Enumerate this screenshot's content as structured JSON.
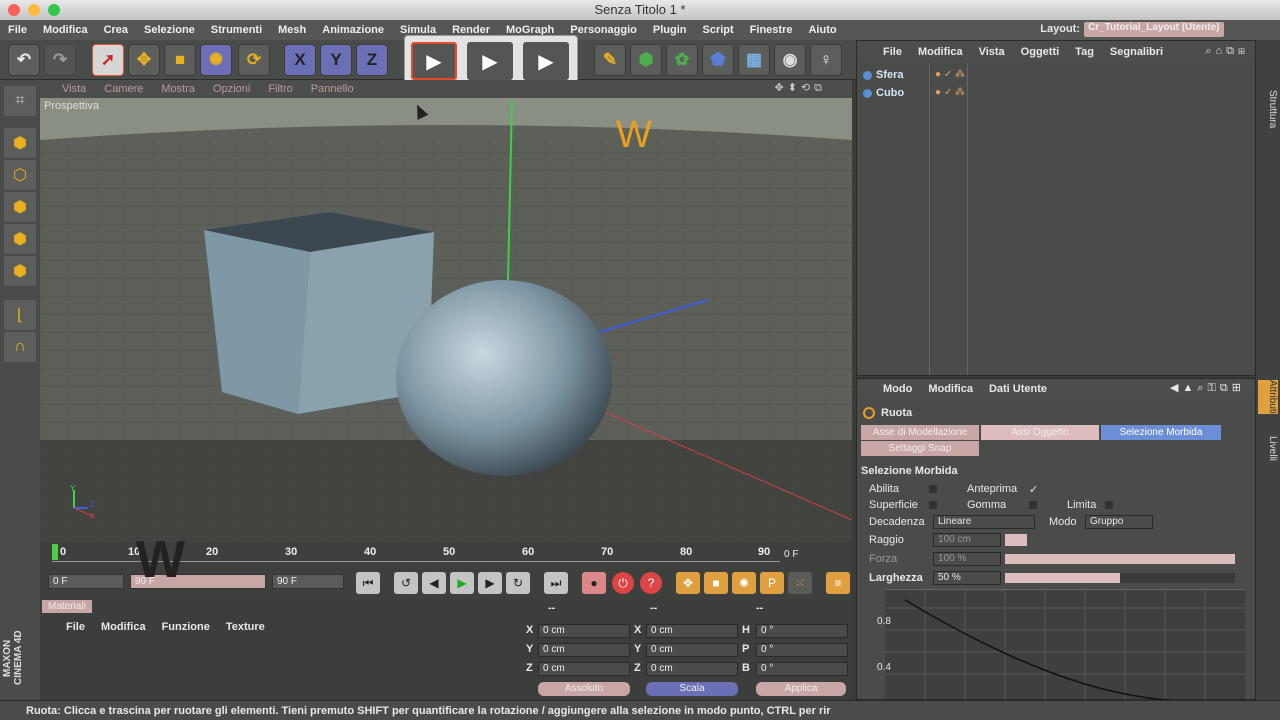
{
  "window": {
    "title": "Senza Titolo 1 *"
  },
  "menubar": {
    "items": [
      "File",
      "Modifica",
      "Crea",
      "Selezione",
      "Strumenti",
      "Mesh",
      "Animazione",
      "Simula",
      "Render",
      "MoGraph",
      "Personaggio",
      "Plugin",
      "Script",
      "Finestre",
      "Aiuto"
    ],
    "layout_label": "Layout:",
    "layout_value": "Cr_Tutorial_Layout (Utente)"
  },
  "toolbar": {
    "axis_x": "X",
    "axis_y": "Y",
    "axis_z": "Z"
  },
  "viewport": {
    "menu": [
      "Vista",
      "Camere",
      "Mostra",
      "Opzioni",
      "Filtro",
      "Pannello"
    ],
    "label": "Prospettiva",
    "overlay_letter": "W",
    "axis_y": "Y",
    "axis_z": "Z",
    "axis_x": "X"
  },
  "timeline": {
    "ticks": [
      "0",
      "10",
      "20",
      "30",
      "40",
      "50",
      "60",
      "70",
      "80",
      "90"
    ],
    "current_frame": "0 F",
    "start_frame": "0 F",
    "end_frame_left": "90 F",
    "end_frame_right": "90 F",
    "overlay_letter": "W"
  },
  "materials": {
    "tab": "Materiali",
    "menu": [
      "File",
      "Modifica",
      "Funzione",
      "Texture"
    ]
  },
  "coordinates": {
    "headers": [
      "--",
      "--",
      "--"
    ],
    "rows": [
      {
        "a": "X",
        "av": "0 cm",
        "b": "X",
        "bv": "0 cm",
        "c": "H",
        "cv": "0 °"
      },
      {
        "a": "Y",
        "av": "0 cm",
        "b": "Y",
        "bv": "0 cm",
        "c": "P",
        "cv": "0 °"
      },
      {
        "a": "Z",
        "av": "0 cm",
        "b": "Z",
        "bv": "0 cm",
        "c": "B",
        "cv": "0 °"
      }
    ],
    "mode1": "Assoluto",
    "mode2": "Scala",
    "apply": "Applica"
  },
  "objects": {
    "menu": [
      "File",
      "Modifica",
      "Vista",
      "Oggetti",
      "Tag",
      "Segnalibri"
    ],
    "items": [
      "Sfera",
      "Cubo"
    ]
  },
  "attributes": {
    "menu": [
      "Modo",
      "Modifica",
      "Dati Utente"
    ],
    "tool_name": "Ruota",
    "tabs": [
      "Asse di Modellazione",
      "Assi Oggetto",
      "Selezione Morbida"
    ],
    "tab_snap": "Settaggi Snap",
    "section": "Selezione Morbida",
    "abilita": "Abilita",
    "anteprima": "Anteprima",
    "anteprima_check": "✓",
    "superficie": "Superficie",
    "gomma": "Gomma",
    "limita": "Limita",
    "decadenza_label": "Decadenza",
    "decadenza_value": "Lineare",
    "modo_label": "Modo",
    "modo_value": "Gruppo",
    "raggio_label": "Raggio",
    "raggio_value": "100 cm",
    "forza_label": "Forza",
    "forza_value": "100 %",
    "larghezza_label": "Larghezza",
    "larghezza_value": "50 %",
    "larghezza_fraction": 0.5,
    "graph_labels": [
      "0.8",
      "0.4"
    ]
  },
  "side_tabs": [
    "Struttura",
    "Attributi",
    "Livelli"
  ],
  "maxon_brand": "MAXON CINEMA 4D",
  "status": {
    "text": "Ruota: Clicca e trascina per ruotare gli elementi. Tieni premuto SHIFT per quantificare la rotazione / aggiungere alla selezione in modo punto, CTRL per rir"
  },
  "colors": {
    "accent": "#e25a2c",
    "selection_tab": "#6b8ed6",
    "pink_ui": "#c9a6a6"
  }
}
